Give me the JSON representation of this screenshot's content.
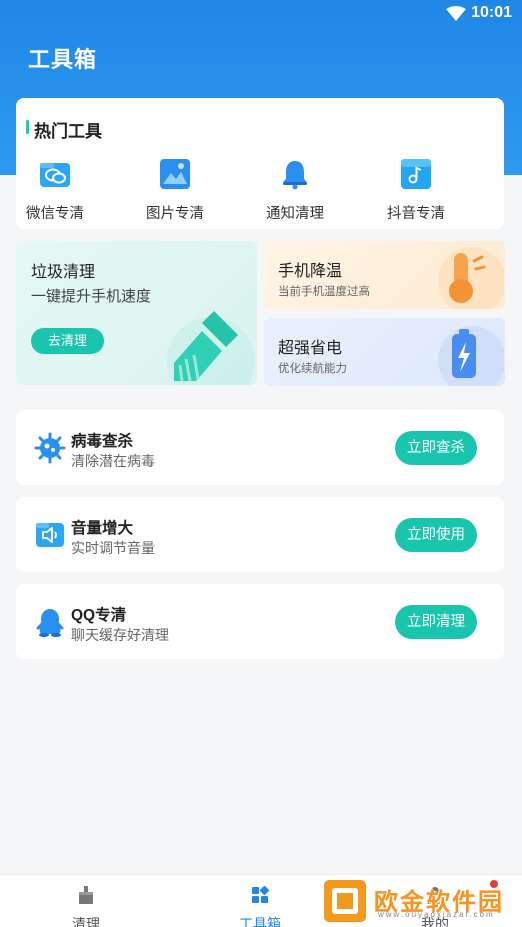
{
  "status_bar": {
    "time": "10:01"
  },
  "header": {
    "title": "工具箱"
  },
  "hot_tools": {
    "title": "热门工具",
    "items": [
      {
        "label": "微信专清",
        "icon": "wechat-chat-icon"
      },
      {
        "label": "图片专清",
        "icon": "image-icon"
      },
      {
        "label": "通知清理",
        "icon": "bell-icon"
      },
      {
        "label": "抖音专清",
        "icon": "music-note-icon"
      }
    ]
  },
  "junk_clean": {
    "title": "垃圾清理",
    "subtitle": "一键提升手机速度",
    "button": "去清理"
  },
  "cool_down": {
    "title": "手机降温",
    "subtitle": "当前手机温度过高"
  },
  "power_save": {
    "title": "超强省电",
    "subtitle": "优化续航能力"
  },
  "features": [
    {
      "name": "病毒查杀",
      "desc": "清除潜在病毒",
      "button": "立即查杀",
      "icon": "virus-icon"
    },
    {
      "name": "音量增大",
      "desc": "实时调节音量",
      "button": "立即使用",
      "icon": "speaker-icon"
    },
    {
      "name": "QQ专清",
      "desc": "聊天缓存好清理",
      "button": "立即清理",
      "icon": "qq-penguin-icon"
    }
  ],
  "tabbar": {
    "items": [
      {
        "label": "清理",
        "icon": "broom-icon"
      },
      {
        "label": "工具箱",
        "icon": "grid-icon",
        "active": true
      },
      {
        "label": "我的",
        "icon": "user-icon"
      }
    ]
  },
  "watermark": {
    "text": "欧金软件园",
    "url": "www.ouyaoxiazai.com"
  },
  "colors": {
    "primary": "#1f86e6",
    "accent": "#19c6ad"
  }
}
